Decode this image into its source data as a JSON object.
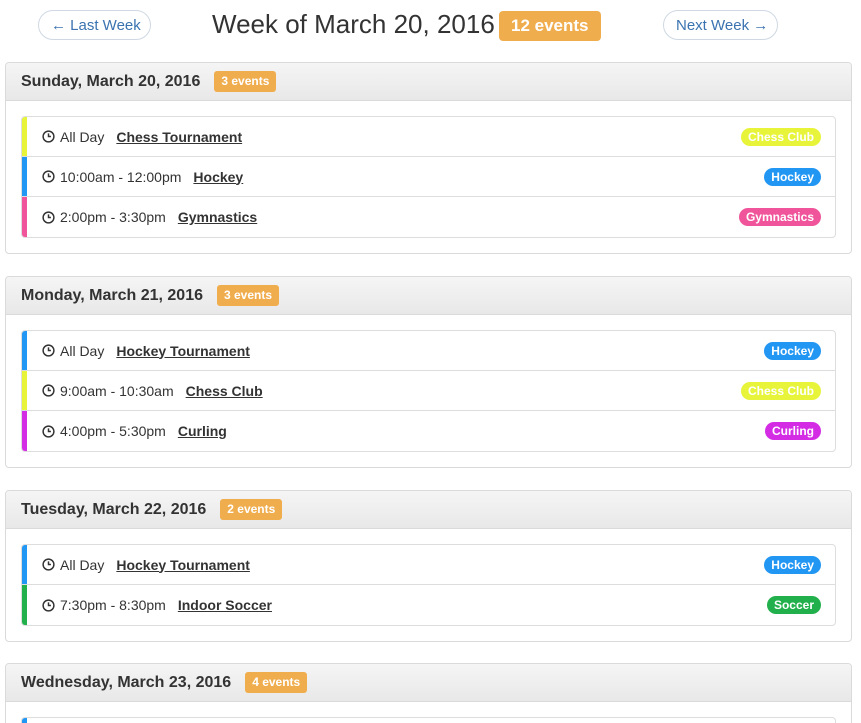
{
  "header": {
    "prev_label": "← Last Week",
    "title": "Week of March 20, 2016",
    "count": "12 events",
    "next_label": "Next Week →"
  },
  "colors": {
    "chess": "#e7f43a",
    "hockey": "#2196f3",
    "gymnastics": "#f0549a",
    "curling": "#d42ce5",
    "soccer": "#21b04b",
    "badge": "#f0ad4e"
  },
  "days": [
    {
      "title": "Sunday, March 20, 2016",
      "count": "3 events",
      "events": [
        {
          "time": "All Day",
          "name": "Chess Tournament",
          "tag": "Chess Club",
          "color": "chess"
        },
        {
          "time": "10:00am - 12:00pm",
          "name": "Hockey",
          "tag": "Hockey",
          "color": "hockey"
        },
        {
          "time": "2:00pm - 3:30pm",
          "name": "Gymnastics",
          "tag": "Gymnastics",
          "color": "gymnastics"
        }
      ]
    },
    {
      "title": "Monday, March 21, 2016",
      "count": "3 events",
      "events": [
        {
          "time": "All Day",
          "name": "Hockey Tournament",
          "tag": "Hockey",
          "color": "hockey"
        },
        {
          "time": "9:00am - 10:30am",
          "name": "Chess Club",
          "tag": "Chess Club",
          "color": "chess"
        },
        {
          "time": "4:00pm - 5:30pm",
          "name": "Curling",
          "tag": "Curling",
          "color": "curling"
        }
      ]
    },
    {
      "title": "Tuesday, March 22, 2016",
      "count": "2 events",
      "events": [
        {
          "time": "All Day",
          "name": "Hockey Tournament",
          "tag": "Hockey",
          "color": "hockey"
        },
        {
          "time": "7:30pm - 8:30pm",
          "name": "Indoor Soccer",
          "tag": "Soccer",
          "color": "soccer"
        }
      ]
    },
    {
      "title": "Wednesday, March 23, 2016",
      "count": "4 events",
      "events": [
        {
          "time": "",
          "name": "",
          "tag": "",
          "color": "hockey"
        }
      ]
    }
  ]
}
